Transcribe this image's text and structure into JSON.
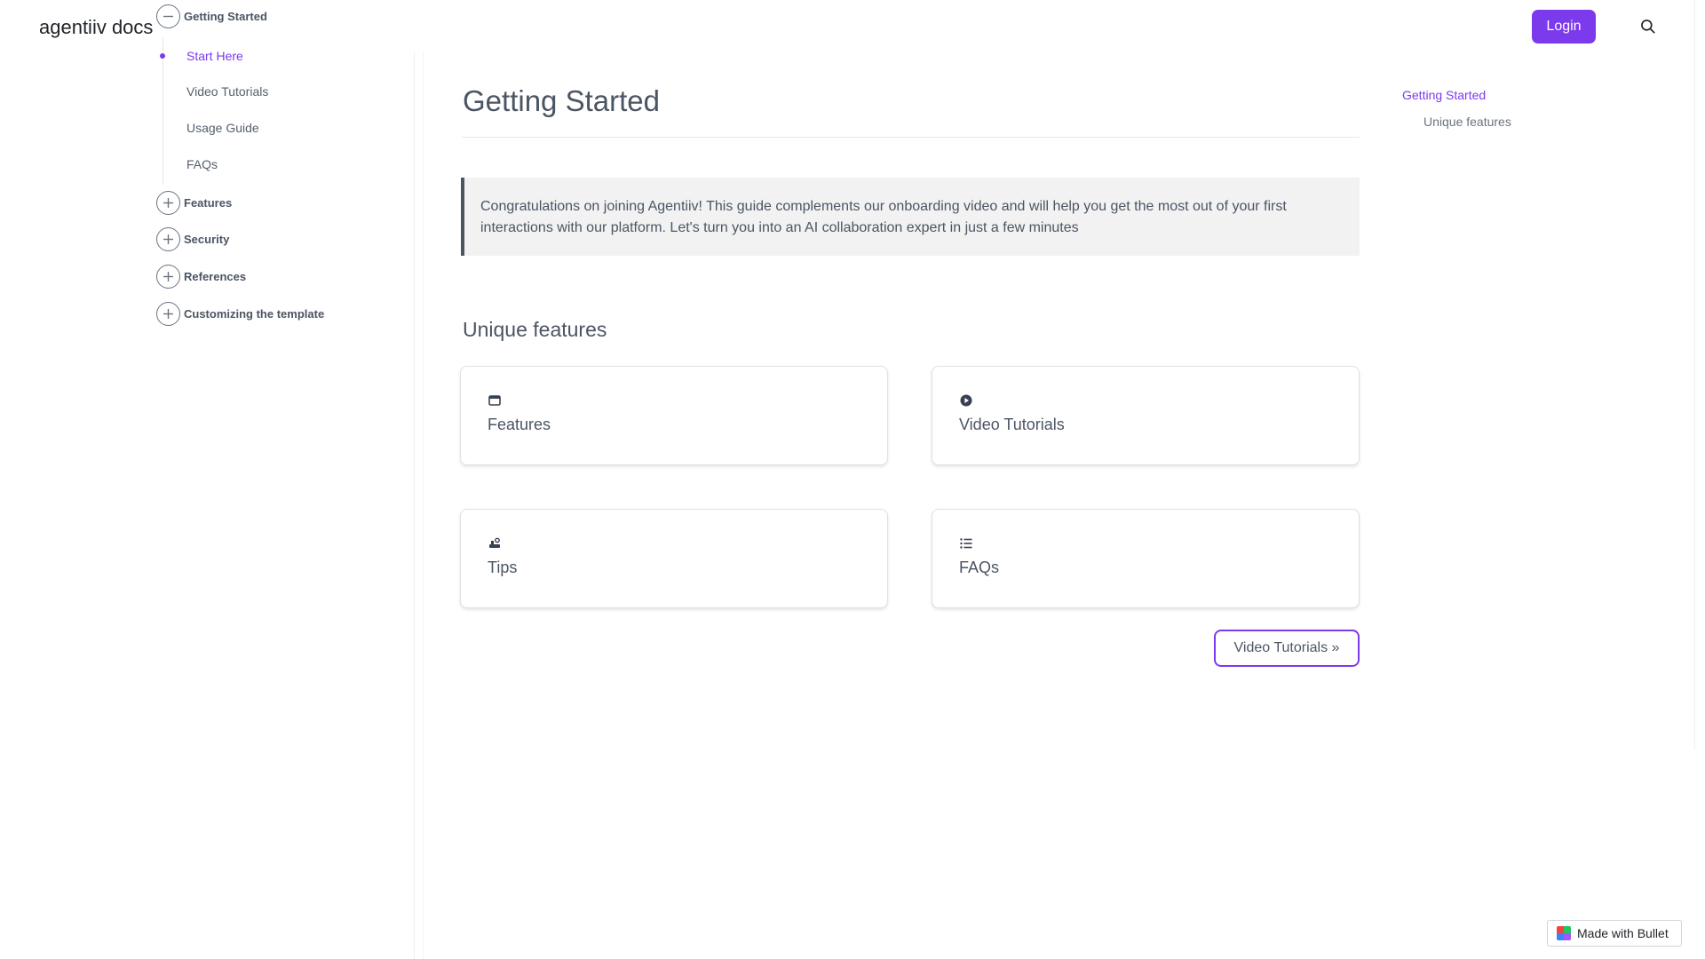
{
  "header": {
    "site_title": "agentiiv docs",
    "login_label": "Login",
    "search_icon": "search-icon"
  },
  "sidebar": {
    "groups": [
      {
        "label": "Getting Started",
        "expanded": true,
        "toggle_icon": "minus-icon"
      },
      {
        "label": "Features",
        "expanded": false,
        "toggle_icon": "plus-icon"
      },
      {
        "label": "Security",
        "expanded": false,
        "toggle_icon": "plus-icon"
      },
      {
        "label": "References",
        "expanded": false,
        "toggle_icon": "plus-icon"
      },
      {
        "label": "Customizing the template",
        "expanded": false,
        "toggle_icon": "plus-icon"
      }
    ],
    "subitems": [
      {
        "label": "Start Here",
        "active": true
      },
      {
        "label": "Video Tutorials",
        "active": false
      },
      {
        "label": "Usage Guide",
        "active": false
      },
      {
        "label": "FAQs",
        "active": false
      }
    ]
  },
  "main": {
    "title": "Getting Started",
    "callout_text": "Congratulations on joining Agentiiv! This guide complements our onboarding video and will help you get the most out of your first interactions with our platform. Let's turn you into an AI collaboration expert in just a few minutes",
    "section_title": "Unique features",
    "cards": [
      {
        "label": "Features",
        "icon": "window-icon"
      },
      {
        "label": "Video Tutorials",
        "icon": "play-circle-icon"
      },
      {
        "label": "Tips",
        "icon": "tips-icon"
      },
      {
        "label": "FAQs",
        "icon": "list-icon"
      }
    ],
    "next_button": "Video Tutorials »"
  },
  "toc": {
    "items": [
      {
        "label": "Getting Started",
        "active": true
      },
      {
        "label": "Unique features",
        "active": false
      }
    ]
  },
  "badge": {
    "label": "Made with Bullet",
    "icon": "bullet-logo-icon"
  },
  "colors": {
    "accent": "#7c3aed",
    "text": "#4b5563",
    "callout_bg": "#f2f2f2"
  }
}
